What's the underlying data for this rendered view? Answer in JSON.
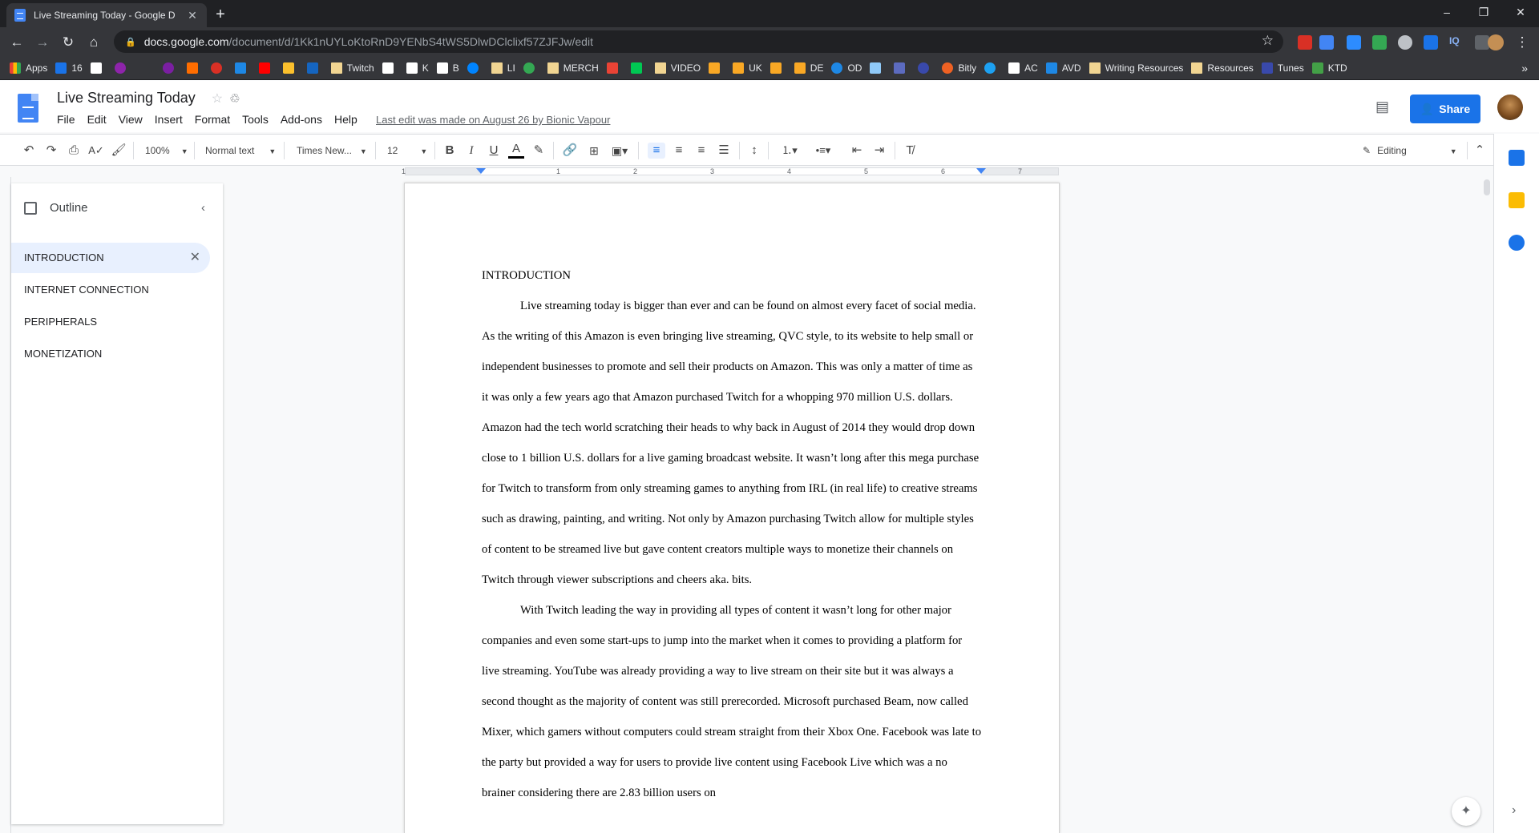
{
  "browser": {
    "tab_title": "Live Streaming Today - Google D",
    "tab_close": "✕",
    "newtab": "+",
    "url_domain": "docs.google.com",
    "url_path": "/document/d/1Kk1nUYLoKtoRnD9YENbS4tWS5DlwDClclixf57ZJFJw/edit",
    "win_min": "–",
    "win_max": "❐",
    "win_close": "✕"
  },
  "bookmarks": [
    "Apps",
    "16",
    "",
    "",
    "",
    "",
    "",
    "",
    "",
    "",
    "",
    "",
    "Twitch",
    "",
    "K",
    "B",
    "",
    "LI",
    "",
    "MERCH",
    "",
    "",
    "VIDEO",
    "",
    "UK",
    "",
    "DE",
    "OD",
    "",
    "",
    "",
    "",
    "Bitly",
    "",
    "AC",
    "AVD",
    "Writing Resources",
    "Resources",
    "Tunes",
    "KTD"
  ],
  "docs": {
    "title": "Live Streaming Today",
    "menus": [
      "File",
      "Edit",
      "View",
      "Insert",
      "Format",
      "Tools",
      "Add-ons",
      "Help"
    ],
    "last_edit": "Last edit was made on August 26 by Bionic Vapour",
    "share_label": "Share"
  },
  "toolbar": {
    "zoom": "100%",
    "style": "Normal text",
    "font": "Times New...",
    "size": "12",
    "mode": "Editing"
  },
  "ruler": {
    "numbers": [
      "1",
      "1",
      "2",
      "3",
      "4",
      "5",
      "6",
      "7"
    ]
  },
  "outline": {
    "title": "Outline",
    "items": [
      "INTRODUCTION",
      "INTERNET CONNECTION",
      "PERIPHERALS",
      "MONETIZATION"
    ]
  },
  "document": {
    "heading": "INTRODUCTION",
    "paragraphs": [
      "Live streaming today is bigger than ever and can be found on almost every facet of social media. As the writing of this Amazon is even bringing live streaming, QVC style, to its website to help small or independent businesses to promote and sell their products on Amazon. This was only a matter of time as it was only a few years ago that Amazon purchased Twitch for a whopping 970 million U.S. dollars. Amazon had the tech world scratching their heads to why back in August of 2014 they would drop down close to 1 billion U.S. dollars for a live gaming broadcast website. It wasn’t long after this mega purchase for Twitch to transform from only streaming games to anything from IRL (in real life) to creative streams such as drawing, painting, and writing. Not only by Amazon purchasing Twitch allow for multiple styles of content to be streamed live but gave content creators multiple ways to monetize their channels on Twitch through viewer subscriptions and cheers aka. bits.",
      "With Twitch leading the way in providing all types of content it wasn’t long for other major companies and even some start-ups to jump into the market when it comes to providing a platform for live streaming. YouTube was already providing a way to live stream on their site but it was always a second thought as the majority of content was still prerecorded. Microsoft purchased Beam, now called Mixer, which gamers without computers could stream straight from their Xbox One. Facebook was late to the party but provided a way for users to provide live content using Facebook Live which was a no brainer considering there are 2.83 billion users on"
    ]
  }
}
